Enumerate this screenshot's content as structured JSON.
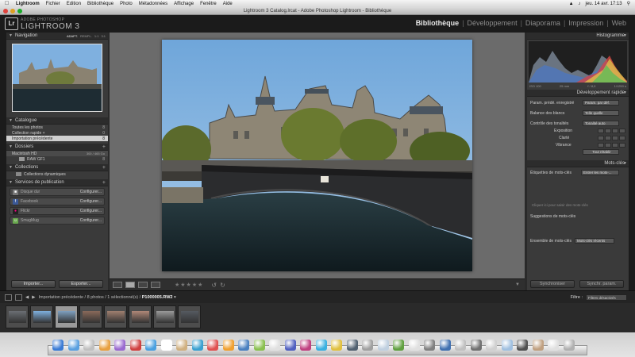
{
  "menubar": {
    "app": "Lightroom",
    "items": [
      "Fichier",
      "Edition",
      "Bibliothèque",
      "Photo",
      "Métadonnées",
      "Affichage",
      "Fenêtre",
      "Aide"
    ],
    "clock": "jeu. 14 avr.  17:13"
  },
  "window": {
    "title": "Lightroom 3 Catalog.lrcat - Adobe Photoshop Lightroom - Bibliothèque"
  },
  "identity": {
    "logo": "Lr",
    "brand_top": "ADOBE PHOTOSHOP",
    "brand": "LIGHTROOM 3"
  },
  "modules": [
    "Bibliothèque",
    "Développement",
    "Diaporama",
    "Impression",
    "Web"
  ],
  "left": {
    "navigation": {
      "title": "Navigation",
      "zoom": [
        "ADAPT.",
        "REMPL.",
        "1:1",
        "3:1"
      ]
    },
    "catalogue": {
      "title": "Catalogue",
      "items": [
        {
          "label": "Toutes les photos",
          "count": "8"
        },
        {
          "label": "Collection rapide +",
          "count": "0"
        },
        {
          "label": "Importation précédente",
          "count": "8"
        }
      ]
    },
    "dossiers": {
      "title": "Dossiers",
      "volume": {
        "label": "Macintosh HD",
        "info": "300 / 465 Go"
      },
      "folder": {
        "label": "RAW GF1",
        "count": "8"
      }
    },
    "collections": {
      "title": "Collections",
      "items": [
        {
          "label": "Collections dynamiques"
        }
      ]
    },
    "services": {
      "title": "Services de publication",
      "items": [
        {
          "label": "Disque dur",
          "action": "Configurer..."
        },
        {
          "label": "Facebook",
          "action": "Configurer..."
        },
        {
          "label": "Flickr",
          "action": "Configurer..."
        },
        {
          "label": "SmugMug",
          "action": "Configurer..."
        }
      ]
    },
    "import_label": "Importer...",
    "export_label": "Exporter..."
  },
  "right": {
    "histogram": {
      "title": "Histogramme",
      "info": [
        "ISO 100",
        "25 mm",
        "f / 8,0",
        "1/1250 s"
      ]
    },
    "quick_dev": {
      "title": "Développement rapide",
      "saved_preset_label": "Param. prédé. enregistré",
      "saved_preset_value": "Param. par déf.",
      "wb_label": "Balance des blancs",
      "wb_value": "Telle quelle",
      "tone_label": "Contrôle des tonalités",
      "auto_tone": "Tonalité auto",
      "exposure": "Exposition",
      "clarity": "Clarté",
      "vibrance": "Vibrance",
      "reset": "Tout rétablir"
    },
    "keywords": {
      "title": "Mots-clés",
      "tags_label": "Étiquettes de mots-clés",
      "tags_value": "Entrer les mots-...",
      "hint": "Cliquer ici pour saisir des mots-clés",
      "suggestions": "Suggestions de mots-clés",
      "set_label": "Ensemble de mots-clés",
      "set_value": "Mots-clés récents"
    },
    "sync_label": "Synchroniser",
    "sync_settings_label": "Synchr. param."
  },
  "filmstrip": {
    "crumb_prefix": "Importation précédente / 8 photos / 1 sélectionné(s) /",
    "crumb_file": "P1000005.RW2",
    "filter_label": "Filtre :",
    "filter_value": "Filtres désactivés",
    "selected_index": 2,
    "thumb_count": 8
  },
  "colors": {
    "panel": "#3a3a3a",
    "active_module": "#e8e8e8",
    "sky": "#7fb0df"
  }
}
